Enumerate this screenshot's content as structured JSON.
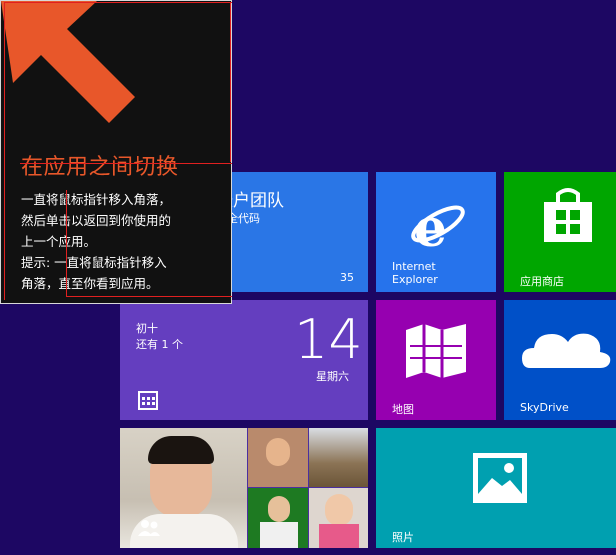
{
  "tooltip": {
    "title": "在应用之间切换",
    "line1": "一直将鼠标指针移入角落，",
    "line2": "然后单击以返回到你使用的",
    "line3": "上一个应用。",
    "line4": "提示: 一直将鼠标指针移入",
    "line5": "角落，直至你看到应用。",
    "arrow_icon": "arrow-up-left-icon"
  },
  "tiles": {
    "account_team": {
      "title": "帐户团队",
      "subtitle": "安全代码",
      "count": "35",
      "color": "#2a76e6"
    },
    "ie": {
      "label_line1": "Internet",
      "label_line2": "Explorer",
      "icon": "ie-icon",
      "color": "#2673ec"
    },
    "store": {
      "label": "应用商店",
      "icon": "store-icon",
      "color": "#00a600"
    },
    "calendar": {
      "line1": "初十",
      "line2": "还有 1 个",
      "day": "14",
      "weekday": "星期六",
      "icon": "calendar-icon",
      "color": "#643ebf"
    },
    "maps": {
      "label": "地图",
      "icon": "map-icon",
      "color": "#9600b0"
    },
    "skydrive": {
      "label": "SkyDrive",
      "icon": "cloud-icon",
      "color": "#0050c8"
    },
    "people": {
      "icon": "people-icon",
      "color": "#4b2fa0"
    },
    "photos": {
      "label": "照片",
      "icon": "photo-icon",
      "color": "#00a0b0"
    }
  }
}
